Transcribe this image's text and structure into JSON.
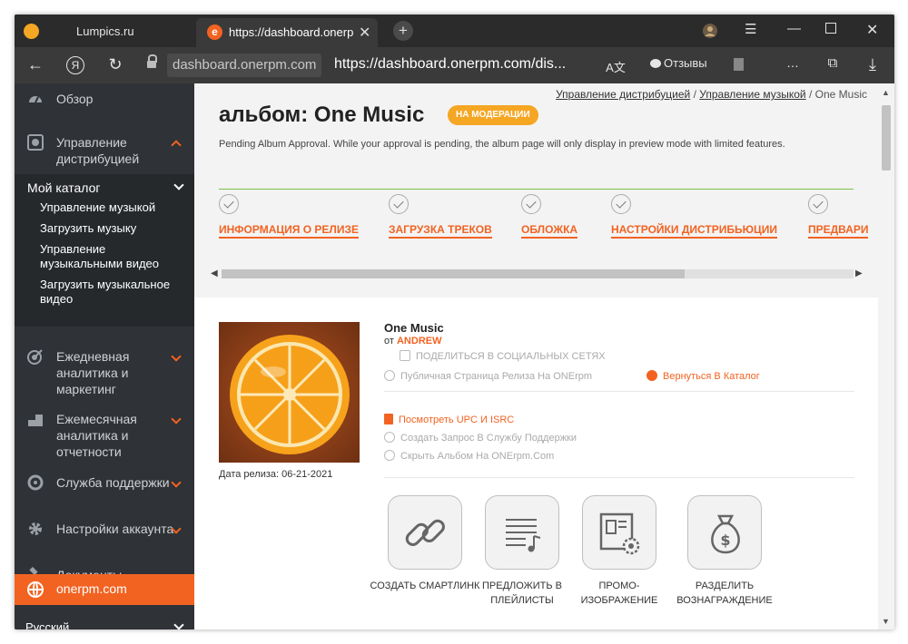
{
  "browser": {
    "tabs": [
      {
        "title": "Lumpics.ru"
      },
      {
        "title": "https://dashboard.onerpm.com"
      }
    ],
    "address": {
      "host": "dashboard.onerpm.com",
      "path": "https://dashboard.onerpm.com/dis..."
    },
    "reviews_label": "Отзывы"
  },
  "sidebar": {
    "items": [
      {
        "label": "Обзор"
      },
      {
        "label": "Управление дистрибуцией"
      },
      {
        "label": "Ежедневная аналитика и маркетинг"
      },
      {
        "label": "Ежемесячная аналитика и отчетности"
      },
      {
        "label": "Служба поддержки"
      },
      {
        "label": "Настройки аккаунта"
      },
      {
        "label": "Документы"
      }
    ],
    "catalog": {
      "title": "Мой каталог",
      "items": [
        {
          "label": "Управление музыкой"
        },
        {
          "label": "Загрузить музыку"
        },
        {
          "label": "Управление музыкальными видео"
        },
        {
          "label": "Загрузить музыкальное видео"
        }
      ]
    },
    "active": {
      "label": "onerpm.com"
    },
    "language": "Русский"
  },
  "breadcrumb": {
    "items": [
      "Управление дистрибуцией",
      "Управление музыкой"
    ],
    "separator": "/",
    "current": "One Music"
  },
  "page": {
    "title": "альбом: One Music",
    "badge": "НА МОДЕРАЦИИ",
    "pending_text": "Pending Album Approval. While your approval is pending, the album page will only display in preview mode with limited features."
  },
  "steps": [
    {
      "label": "ИНФОРМАЦИЯ О РЕЛИЗЕ"
    },
    {
      "label": "ЗАГРУЗКА ТРЕКОВ"
    },
    {
      "label": "ОБЛОЖКА"
    },
    {
      "label": "НАСТРОЙКИ ДИСТРИБЬЮЦИИ"
    },
    {
      "label": "ПРЕДВАРИ"
    }
  ],
  "album": {
    "name": "One Music",
    "by_prefix": "от",
    "artist": "ANDREW",
    "release_date": "Дата релиза: 06-21-2021"
  },
  "actions": {
    "share": "ПОДЕЛИТЬСЯ В СОЦИАЛЬНЫХ СЕТЯХ",
    "public_page": "Публичная Страница Релиза На ONErpm",
    "back_catalog": "Вернуться В Каталог",
    "view_upc": "Посмотреть UPC И ISRC",
    "support": "Создать Запрос В Службу Поддержки",
    "hide": "Скрыть Альбом На ONErpm.Com"
  },
  "tools": [
    {
      "label": "СОЗДАТЬ СМАРТЛИНК"
    },
    {
      "label": "ПРЕДЛОЖИТЬ В ПЛЕЙЛИСТЫ"
    },
    {
      "label": "ПРОМО-ИЗОБРАЖЕНИЕ"
    },
    {
      "label": "РАЗДЕЛИТЬ ВОЗНАГРАЖДЕНИЕ"
    }
  ],
  "colors": {
    "accent": "#f26322",
    "badge": "#f5a623",
    "sidebar_bg": "#2f3236",
    "progress_line": "#7ac143"
  }
}
